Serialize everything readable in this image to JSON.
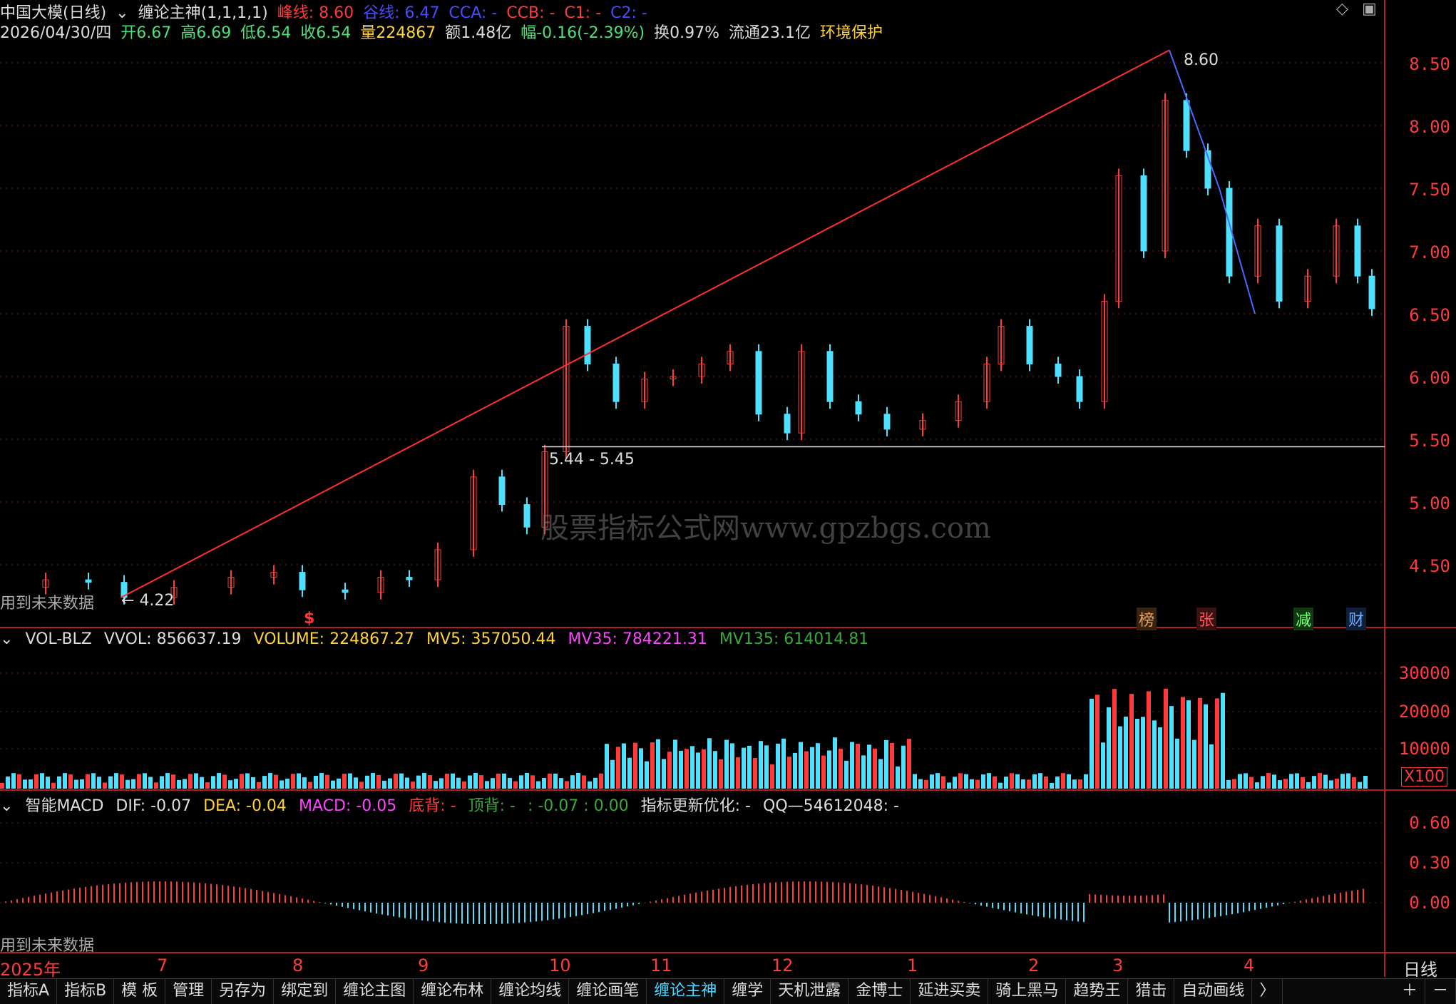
{
  "title_bar": {
    "stock": "中国大模(日线)",
    "indicator": "缠论主神(1,1,1,1)",
    "peak_label": "峰线: 8.60",
    "valley_label": "谷线: 6.47",
    "cca": "CCA: -",
    "ccb": "CCB: -",
    "c1": "C1: -",
    "c2": "C2: -"
  },
  "info_bar": {
    "date": "2026/04/30/四",
    "open": "开6.67",
    "high": "高6.69",
    "low": "低6.54",
    "close": "收6.54",
    "volume": "量224867",
    "amount": "额1.48亿",
    "change": "幅-0.16(-2.39%)",
    "turnover": "换0.97%",
    "float": "流通23.1亿",
    "sector": "环境保护"
  },
  "price_axis": [
    "8.50",
    "8.00",
    "7.50",
    "7.00",
    "6.50",
    "6.00",
    "5.50",
    "5.00",
    "4.50"
  ],
  "price_annotations": {
    "peak": "8.60",
    "low": "4.22",
    "range": "5.44 - 5.45",
    "future_note": "用到未来数据",
    "dollar": "$"
  },
  "badges": [
    "榜",
    "张",
    "减",
    "财"
  ],
  "volume_panel": {
    "name": "VOL-BLZ",
    "vvol": "VVOL: 856637.19",
    "volume": "VOLUME: 224867.27",
    "mv5": "MV5: 357050.44",
    "mv35": "MV35: 784221.31",
    "mv135": "MV135: 614014.81",
    "axis": [
      "30000",
      "20000",
      "10000"
    ],
    "unit": "X100"
  },
  "macd_panel": {
    "name": "智能MACD",
    "dif": "DIF: -0.07",
    "dea": "DEA: -0.04",
    "macd": "MACD: -0.05",
    "bottom_div": "底背: -",
    "top_div": "顶背: -",
    "extra": ": -0.07 : 0.00",
    "update": "指标更新优化: -",
    "qq": "QQ—54612048: -",
    "axis": [
      "0.60",
      "0.30",
      "0.00"
    ],
    "future_note": "用到未来数据"
  },
  "date_axis": [
    "2025年",
    "7",
    "8",
    "9",
    "10",
    "11",
    "12",
    "1",
    "2",
    "3",
    "4"
  ],
  "period": "日线",
  "tabs": [
    "指标A",
    "指标B",
    "模 板",
    "管理",
    "另存为",
    "绑定到",
    "缠论主图",
    "缠论布林",
    "缠论均线",
    "缠论画笔",
    "缠论主神",
    "缠学",
    "天机泄露",
    "金博士",
    "延进买卖",
    "骑上黑马",
    "趋势王",
    "猎击",
    "自动画线"
  ],
  "active_tab": "缠论主神",
  "watermark": "股票指标公式网www.gpzbgs.com",
  "colors": {
    "up": "#ff3b3b",
    "down": "#4fe0ff",
    "accent": "#ffd23a",
    "magenta": "#ff44ff"
  }
}
